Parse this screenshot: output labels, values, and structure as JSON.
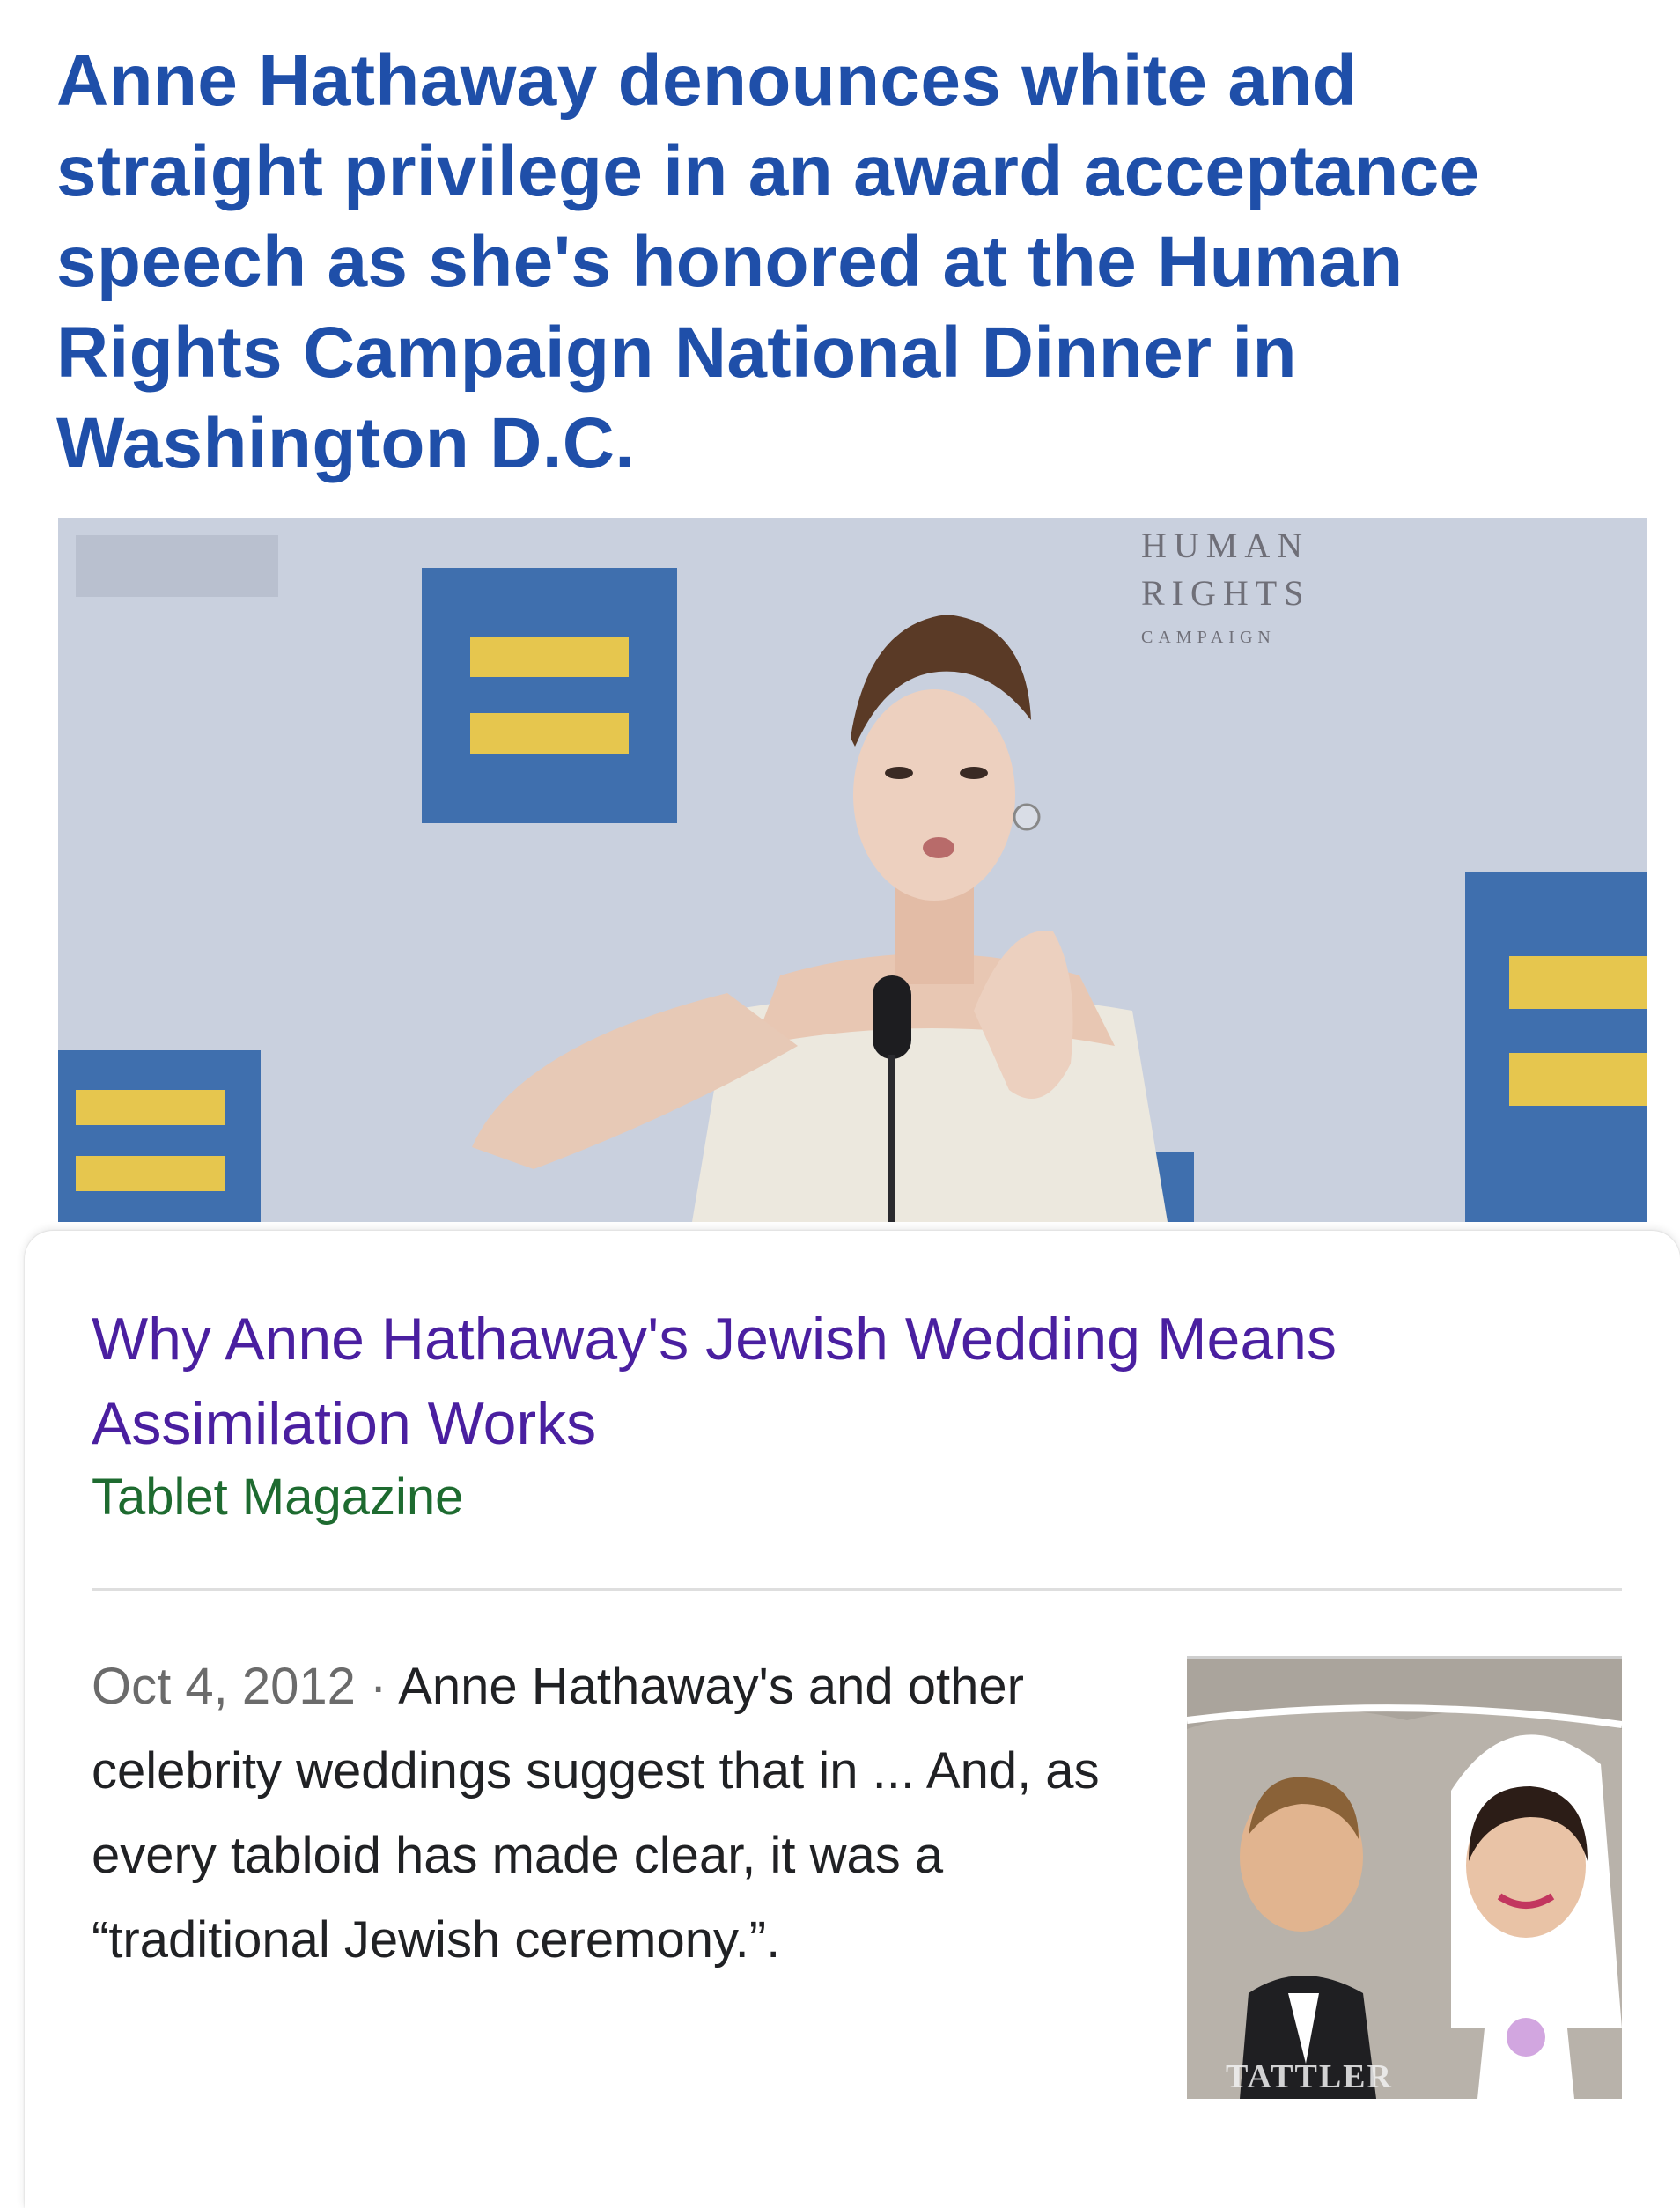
{
  "headline": "Anne Hathaway denounces white and straight privilege in an award acceptance speech as she's honored at the Human Rights Campaign National Dinner in Washington D.C.",
  "photo": {
    "backdrop_wordmark": [
      "HUMAN",
      "RIGHTS",
      "CAMPAIGN"
    ],
    "colors": {
      "backdrop": "#c8cfdd",
      "logo_blue": "#3f6fae",
      "logo_yellow": "#e6c64e"
    }
  },
  "result": {
    "title": "Why Anne Hathaway's Jewish Wedding Means Assimilation Works",
    "source": "Tablet Magazine",
    "date": "Oct 4, 2012",
    "separator": " · ",
    "snippet": "Anne Hathaway's and other celebrity weddings suggest that in ... And, as every tabloid has made clear, it was a “traditional Jewish ceremony.”.",
    "thumbnail_watermark": "TATTLER"
  },
  "colors": {
    "headline": "#1f4fa9",
    "result_title": "#4a1fa0",
    "source": "#1e6b30",
    "date": "#6b6b6b"
  }
}
